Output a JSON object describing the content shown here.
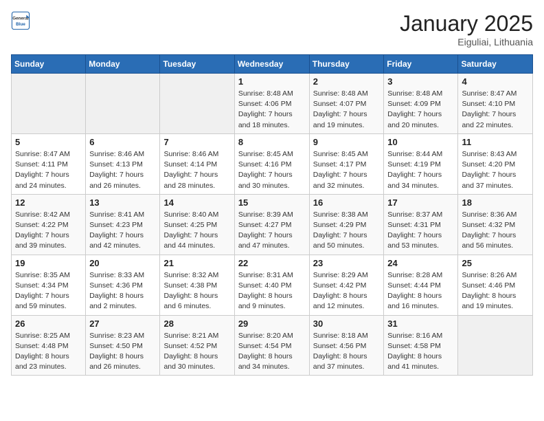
{
  "header": {
    "logo_general": "General",
    "logo_blue": "Blue",
    "month_title": "January 2025",
    "location": "Eiguliai, Lithuania"
  },
  "weekdays": [
    "Sunday",
    "Monday",
    "Tuesday",
    "Wednesday",
    "Thursday",
    "Friday",
    "Saturday"
  ],
  "weeks": [
    [
      {
        "day": "",
        "info": ""
      },
      {
        "day": "",
        "info": ""
      },
      {
        "day": "",
        "info": ""
      },
      {
        "day": "1",
        "info": "Sunrise: 8:48 AM\nSunset: 4:06 PM\nDaylight: 7 hours\nand 18 minutes."
      },
      {
        "day": "2",
        "info": "Sunrise: 8:48 AM\nSunset: 4:07 PM\nDaylight: 7 hours\nand 19 minutes."
      },
      {
        "day": "3",
        "info": "Sunrise: 8:48 AM\nSunset: 4:09 PM\nDaylight: 7 hours\nand 20 minutes."
      },
      {
        "day": "4",
        "info": "Sunrise: 8:47 AM\nSunset: 4:10 PM\nDaylight: 7 hours\nand 22 minutes."
      }
    ],
    [
      {
        "day": "5",
        "info": "Sunrise: 8:47 AM\nSunset: 4:11 PM\nDaylight: 7 hours\nand 24 minutes."
      },
      {
        "day": "6",
        "info": "Sunrise: 8:46 AM\nSunset: 4:13 PM\nDaylight: 7 hours\nand 26 minutes."
      },
      {
        "day": "7",
        "info": "Sunrise: 8:46 AM\nSunset: 4:14 PM\nDaylight: 7 hours\nand 28 minutes."
      },
      {
        "day": "8",
        "info": "Sunrise: 8:45 AM\nSunset: 4:16 PM\nDaylight: 7 hours\nand 30 minutes."
      },
      {
        "day": "9",
        "info": "Sunrise: 8:45 AM\nSunset: 4:17 PM\nDaylight: 7 hours\nand 32 minutes."
      },
      {
        "day": "10",
        "info": "Sunrise: 8:44 AM\nSunset: 4:19 PM\nDaylight: 7 hours\nand 34 minutes."
      },
      {
        "day": "11",
        "info": "Sunrise: 8:43 AM\nSunset: 4:20 PM\nDaylight: 7 hours\nand 37 minutes."
      }
    ],
    [
      {
        "day": "12",
        "info": "Sunrise: 8:42 AM\nSunset: 4:22 PM\nDaylight: 7 hours\nand 39 minutes."
      },
      {
        "day": "13",
        "info": "Sunrise: 8:41 AM\nSunset: 4:23 PM\nDaylight: 7 hours\nand 42 minutes."
      },
      {
        "day": "14",
        "info": "Sunrise: 8:40 AM\nSunset: 4:25 PM\nDaylight: 7 hours\nand 44 minutes."
      },
      {
        "day": "15",
        "info": "Sunrise: 8:39 AM\nSunset: 4:27 PM\nDaylight: 7 hours\nand 47 minutes."
      },
      {
        "day": "16",
        "info": "Sunrise: 8:38 AM\nSunset: 4:29 PM\nDaylight: 7 hours\nand 50 minutes."
      },
      {
        "day": "17",
        "info": "Sunrise: 8:37 AM\nSunset: 4:31 PM\nDaylight: 7 hours\nand 53 minutes."
      },
      {
        "day": "18",
        "info": "Sunrise: 8:36 AM\nSunset: 4:32 PM\nDaylight: 7 hours\nand 56 minutes."
      }
    ],
    [
      {
        "day": "19",
        "info": "Sunrise: 8:35 AM\nSunset: 4:34 PM\nDaylight: 7 hours\nand 59 minutes."
      },
      {
        "day": "20",
        "info": "Sunrise: 8:33 AM\nSunset: 4:36 PM\nDaylight: 8 hours\nand 2 minutes."
      },
      {
        "day": "21",
        "info": "Sunrise: 8:32 AM\nSunset: 4:38 PM\nDaylight: 8 hours\nand 6 minutes."
      },
      {
        "day": "22",
        "info": "Sunrise: 8:31 AM\nSunset: 4:40 PM\nDaylight: 8 hours\nand 9 minutes."
      },
      {
        "day": "23",
        "info": "Sunrise: 8:29 AM\nSunset: 4:42 PM\nDaylight: 8 hours\nand 12 minutes."
      },
      {
        "day": "24",
        "info": "Sunrise: 8:28 AM\nSunset: 4:44 PM\nDaylight: 8 hours\nand 16 minutes."
      },
      {
        "day": "25",
        "info": "Sunrise: 8:26 AM\nSunset: 4:46 PM\nDaylight: 8 hours\nand 19 minutes."
      }
    ],
    [
      {
        "day": "26",
        "info": "Sunrise: 8:25 AM\nSunset: 4:48 PM\nDaylight: 8 hours\nand 23 minutes."
      },
      {
        "day": "27",
        "info": "Sunrise: 8:23 AM\nSunset: 4:50 PM\nDaylight: 8 hours\nand 26 minutes."
      },
      {
        "day": "28",
        "info": "Sunrise: 8:21 AM\nSunset: 4:52 PM\nDaylight: 8 hours\nand 30 minutes."
      },
      {
        "day": "29",
        "info": "Sunrise: 8:20 AM\nSunset: 4:54 PM\nDaylight: 8 hours\nand 34 minutes."
      },
      {
        "day": "30",
        "info": "Sunrise: 8:18 AM\nSunset: 4:56 PM\nDaylight: 8 hours\nand 37 minutes."
      },
      {
        "day": "31",
        "info": "Sunrise: 8:16 AM\nSunset: 4:58 PM\nDaylight: 8 hours\nand 41 minutes."
      },
      {
        "day": "",
        "info": ""
      }
    ]
  ]
}
